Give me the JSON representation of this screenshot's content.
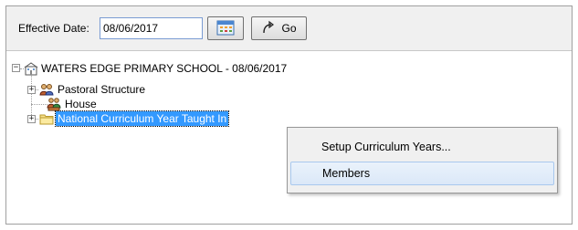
{
  "toolbar": {
    "effective_date_label": "Effective Date:",
    "effective_date_value": "08/06/2017",
    "go_label": "Go",
    "calendar_icon": "calendar-icon",
    "go_icon": "curved-arrow-icon"
  },
  "tree": {
    "root": {
      "label": "WATERS EDGE PRIMARY SCHOOL - 08/06/2017",
      "icon": "school-building-icon",
      "expanded": true
    },
    "children": [
      {
        "label": "Pastoral Structure",
        "icon": "group-people-icon",
        "expanded": false
      },
      {
        "label": "House",
        "icon": "house-group-icon"
      },
      {
        "label": "National Curriculum Year Taught In",
        "icon": "folder-icon",
        "expanded": false,
        "selected": true
      }
    ]
  },
  "context_menu": {
    "items": [
      {
        "label": "Setup Curriculum Years..."
      },
      {
        "label": "Members",
        "highlighted": true
      }
    ]
  },
  "colors": {
    "selection": "#3399ff",
    "menu_highlight_border": "#a8c8ee",
    "toolbar_bg": "#f0f0f0"
  }
}
